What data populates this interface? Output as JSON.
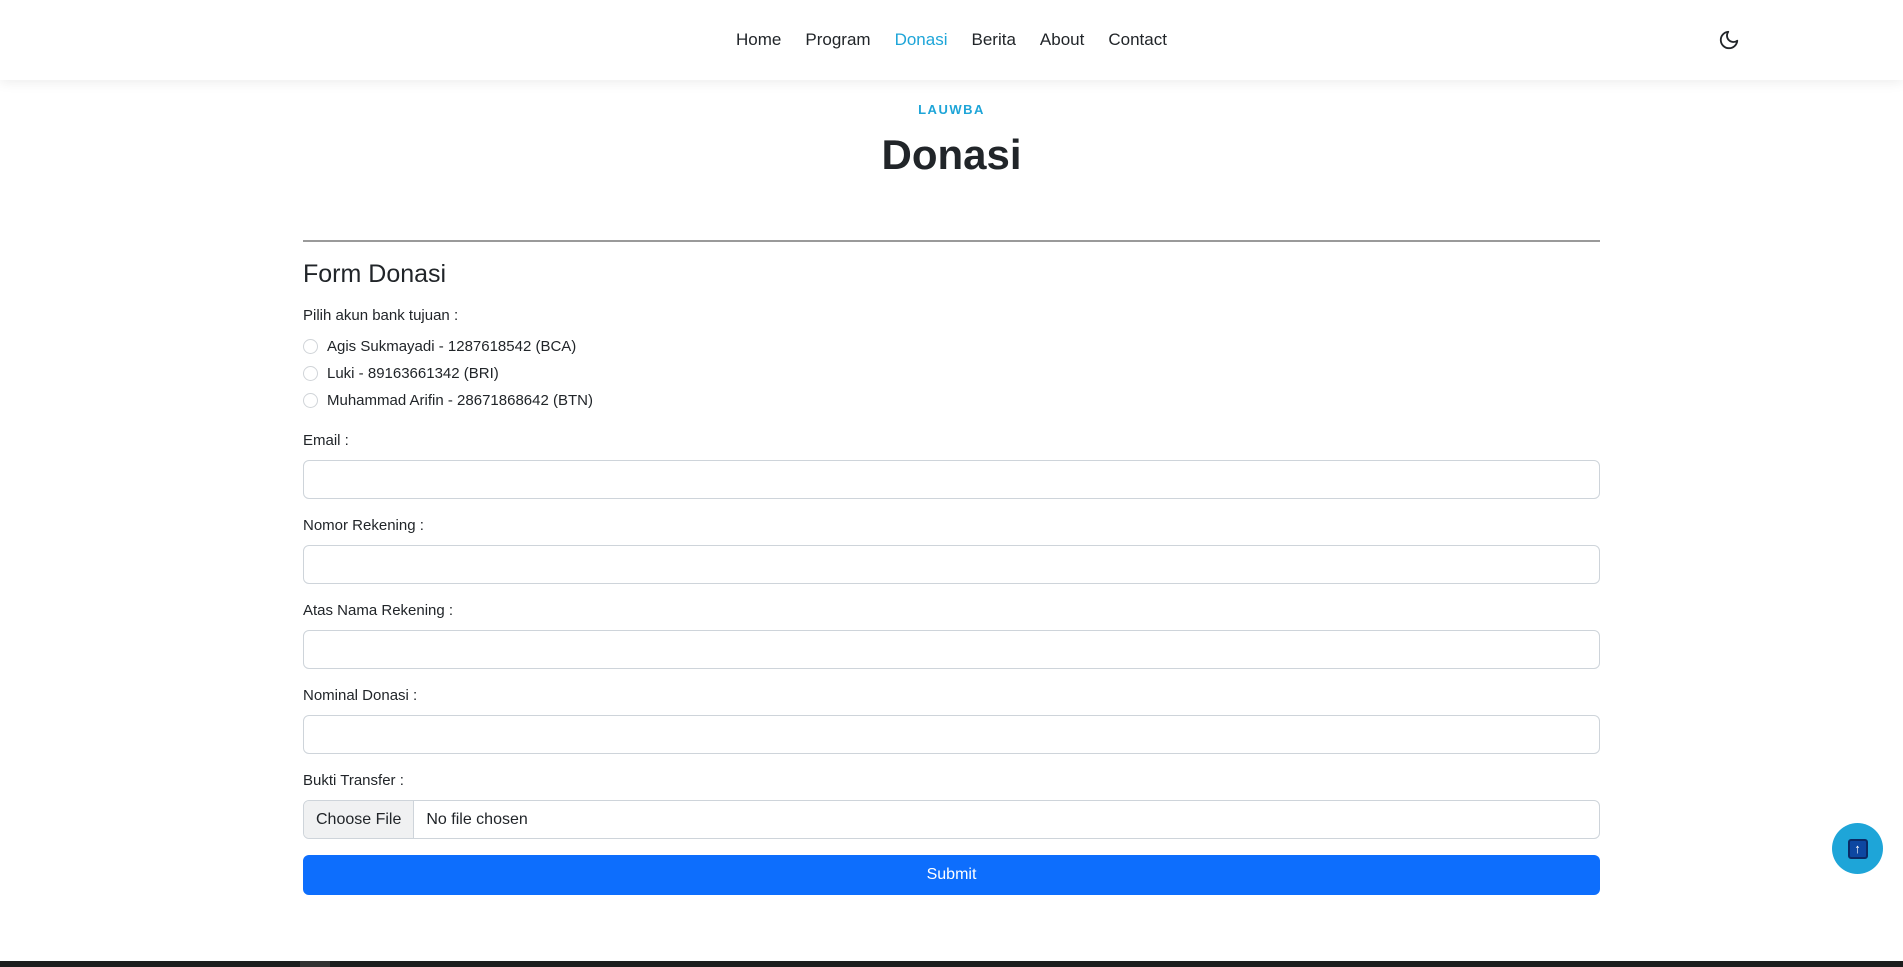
{
  "nav": {
    "items": [
      {
        "label": "Home",
        "active": false
      },
      {
        "label": "Program",
        "active": false
      },
      {
        "label": "Donasi",
        "active": true
      },
      {
        "label": "Berita",
        "active": false
      },
      {
        "label": "About",
        "active": false
      },
      {
        "label": "Contact",
        "active": false
      }
    ],
    "theme_icon": "moon-icon"
  },
  "header": {
    "eyebrow": "LAUWBA",
    "title": "Donasi"
  },
  "form": {
    "title": "Form Donasi",
    "bank_label": "Pilih akun bank tujuan :",
    "banks": [
      "Agis Sukmayadi - 1287618542 (BCA)",
      "Luki - 89163661342 (BRI)",
      "Muhammad Arifin - 28671868642 (BTN)"
    ],
    "email_label": "Email :",
    "email_value": "",
    "rekening_label": "Nomor Rekening :",
    "rekening_value": "",
    "atas_nama_label": "Atas Nama Rekening :",
    "atas_nama_value": "",
    "nominal_label": "Nominal Donasi :",
    "nominal_value": "",
    "bukti_label": "Bukti Transfer :",
    "file_button": "Choose File",
    "file_status": "No file chosen",
    "submit_label": "Submit"
  },
  "colors": {
    "accent": "#1ea5d8",
    "primary": "#0d6efd"
  },
  "back_to_top_icon": "arrow-up-icon"
}
